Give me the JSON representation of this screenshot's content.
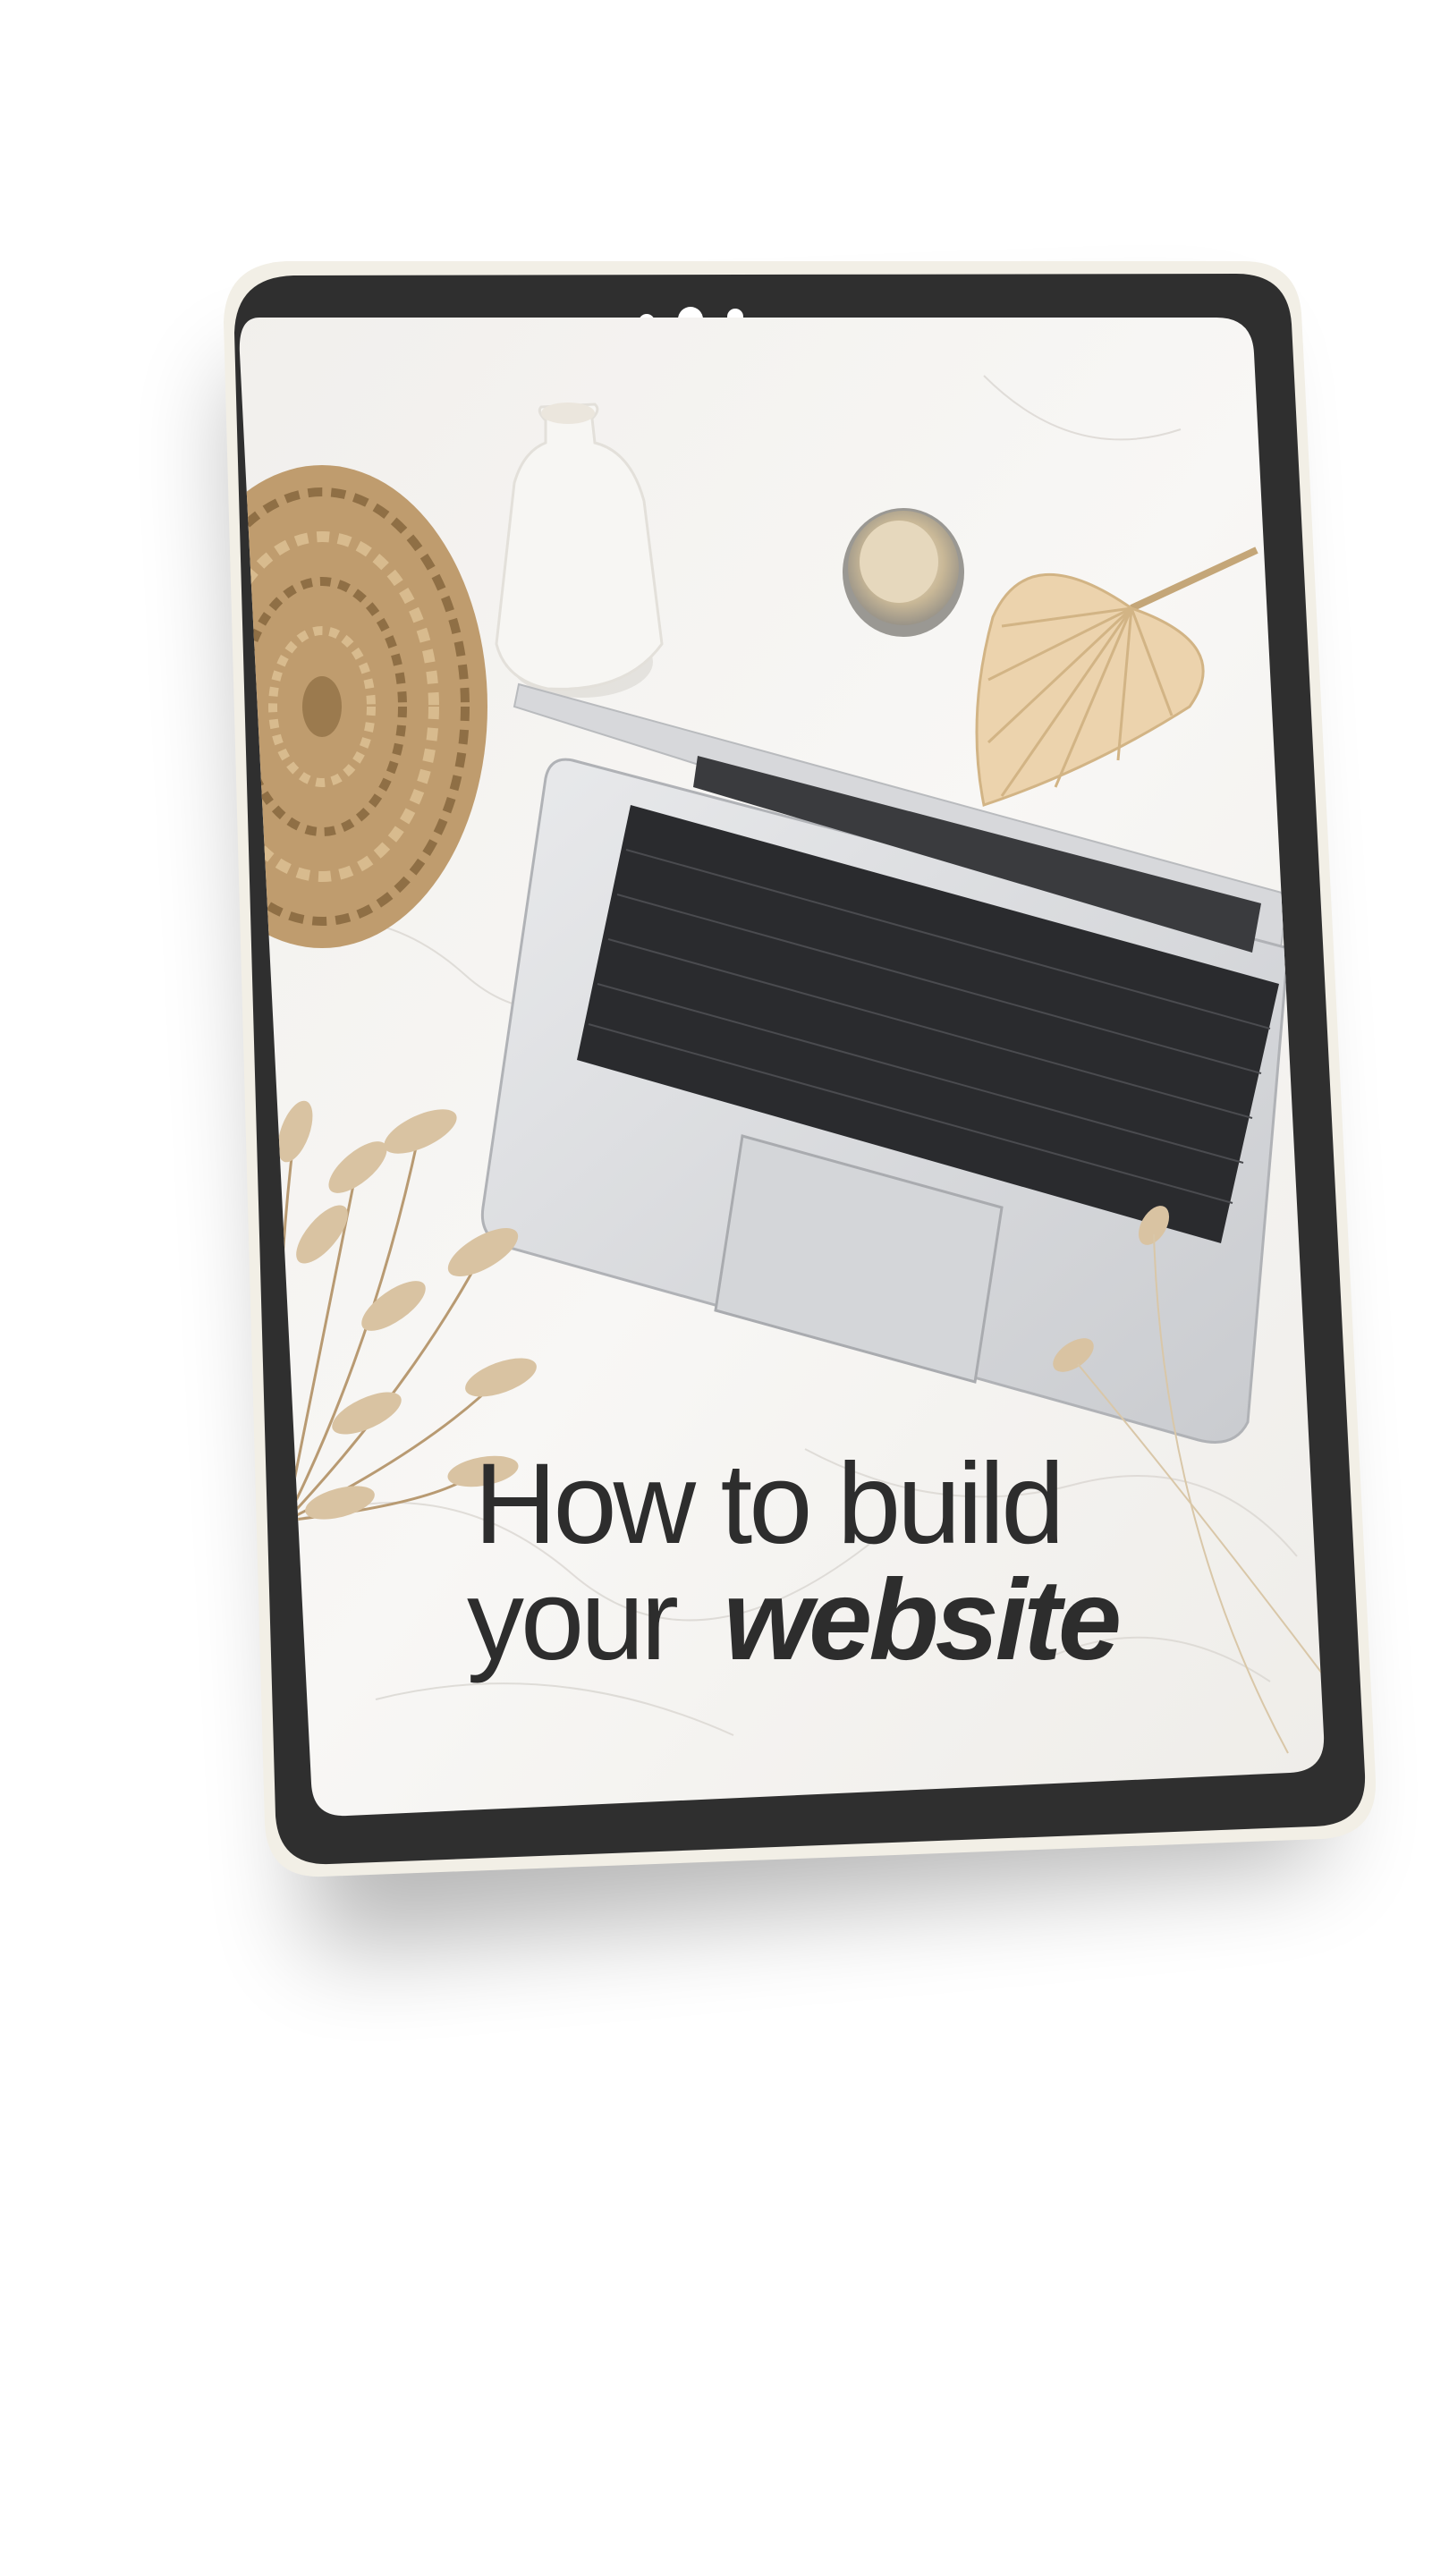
{
  "cover": {
    "line1": "How to build",
    "line2_regular": "your",
    "line2_emphasis": "website"
  },
  "colors": {
    "bezel": "#2f2f2f",
    "frame_edge": "#f2efe6",
    "marble": "#f4f2ef",
    "text": "#2d2d2d",
    "straw": "#c9a87a"
  },
  "icons": {
    "camera": "front-camera-icon"
  }
}
